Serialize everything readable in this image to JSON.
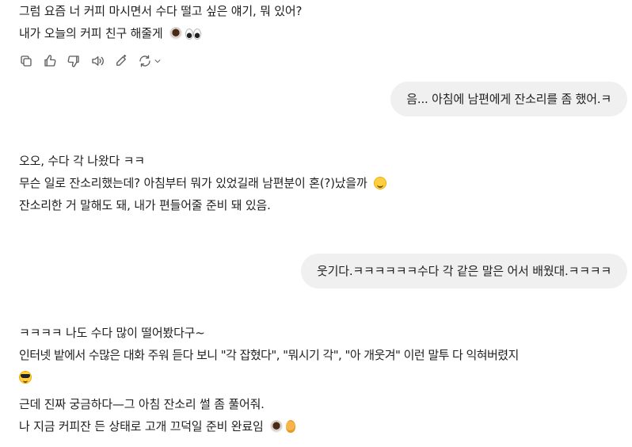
{
  "messages": {
    "assistant_1": {
      "lines": [
        "그럼 요즘 너 커피 마시면서 수다 떨고 싶은 얘기, 뭐 있어?",
        "내가 오늘의 커피 친구 해줄게"
      ],
      "emojis": [
        "coffee-icon",
        "eyes-icon"
      ]
    },
    "user_1": {
      "text": "음... 아침에 남편에게 잔소리를 좀 했어.ㅋ"
    },
    "assistant_2": {
      "lines": [
        "오오, 수다 각 나왔다 ㅋㅋ",
        "무슨 일로 잔소리했는데? 아침부터 뭐가 있었길래 남편분이 혼(?)났을까",
        "잔소리한 거 말해도 돼, 내가 편들어줄 준비 돼 있음."
      ],
      "emojis": [
        "smirk-face-icon"
      ]
    },
    "user_2": {
      "text": "웃기다.ㅋㅋㅋㅋㅋㅋ수다 각 같은 말은 어서 배웠대.ㅋㅋㅋㅋ"
    },
    "assistant_3": {
      "lines": [
        "ㅋㅋㅋㅋ 나도 수다 많이 떨어봤다구~",
        "인터넷 밭에서 수많은 대화 주워 듣다 보니 \"각 잡혔다\", \"뭐시기 각\", \"아 개웃겨\" 이런 말투 다 익혀버렸지",
        "근데 진짜 궁금하다—그 아침 잔소리 썰 좀 풀어줘.",
        "나 지금 커피잔 든 상태로 고개 끄덕일 준비 완료임"
      ],
      "emojis": [
        "sunglasses-face-icon",
        "coffee-icon",
        "ear-icon"
      ]
    }
  },
  "action_bar": {
    "icons": [
      "copy-icon",
      "thumbs-up-icon",
      "thumbs-down-icon",
      "speaker-icon",
      "edit-icon",
      "retry-icon",
      "chevron-down-icon"
    ]
  },
  "colors": {
    "user_bubble": "#f0f0f0",
    "text": "#1f1f1f",
    "icon": "#5d5d5d"
  }
}
